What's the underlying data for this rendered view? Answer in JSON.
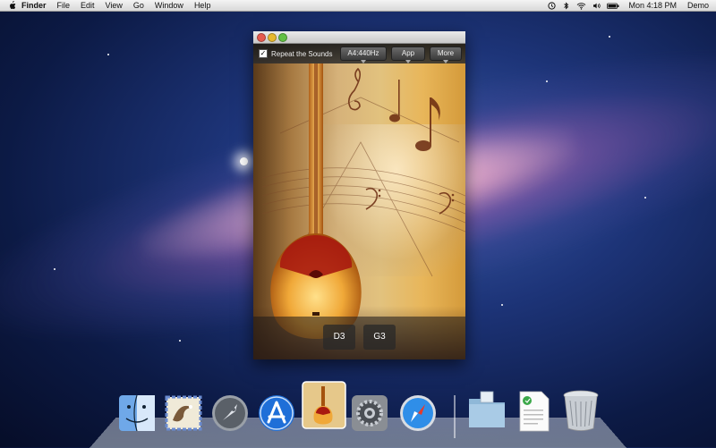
{
  "menubar": {
    "app_name": "Finder",
    "menus": [
      "File",
      "Edit",
      "View",
      "Go",
      "Window",
      "Help"
    ],
    "clock": "Mon 4:18 PM",
    "user": "Demo"
  },
  "window": {
    "toolbar": {
      "repeat_label": "Repeat the Sounds",
      "repeat_checked": true,
      "tuning_button": "A4:440Hz",
      "app_button": "App",
      "more_button": "More"
    },
    "notes": [
      "D3",
      "G3"
    ]
  },
  "dock": {
    "items": [
      "finder-icon",
      "mail-icon",
      "launchpad-icon",
      "app-store-icon",
      "instrument-app-icon",
      "system-preferences-icon",
      "safari-icon",
      "applications-folder-icon",
      "document-icon",
      "trash-icon"
    ]
  },
  "colors": {
    "menubar": "#e6e6e6",
    "wood": "#e8b65a",
    "dock_glass": "#b8c0cc"
  }
}
